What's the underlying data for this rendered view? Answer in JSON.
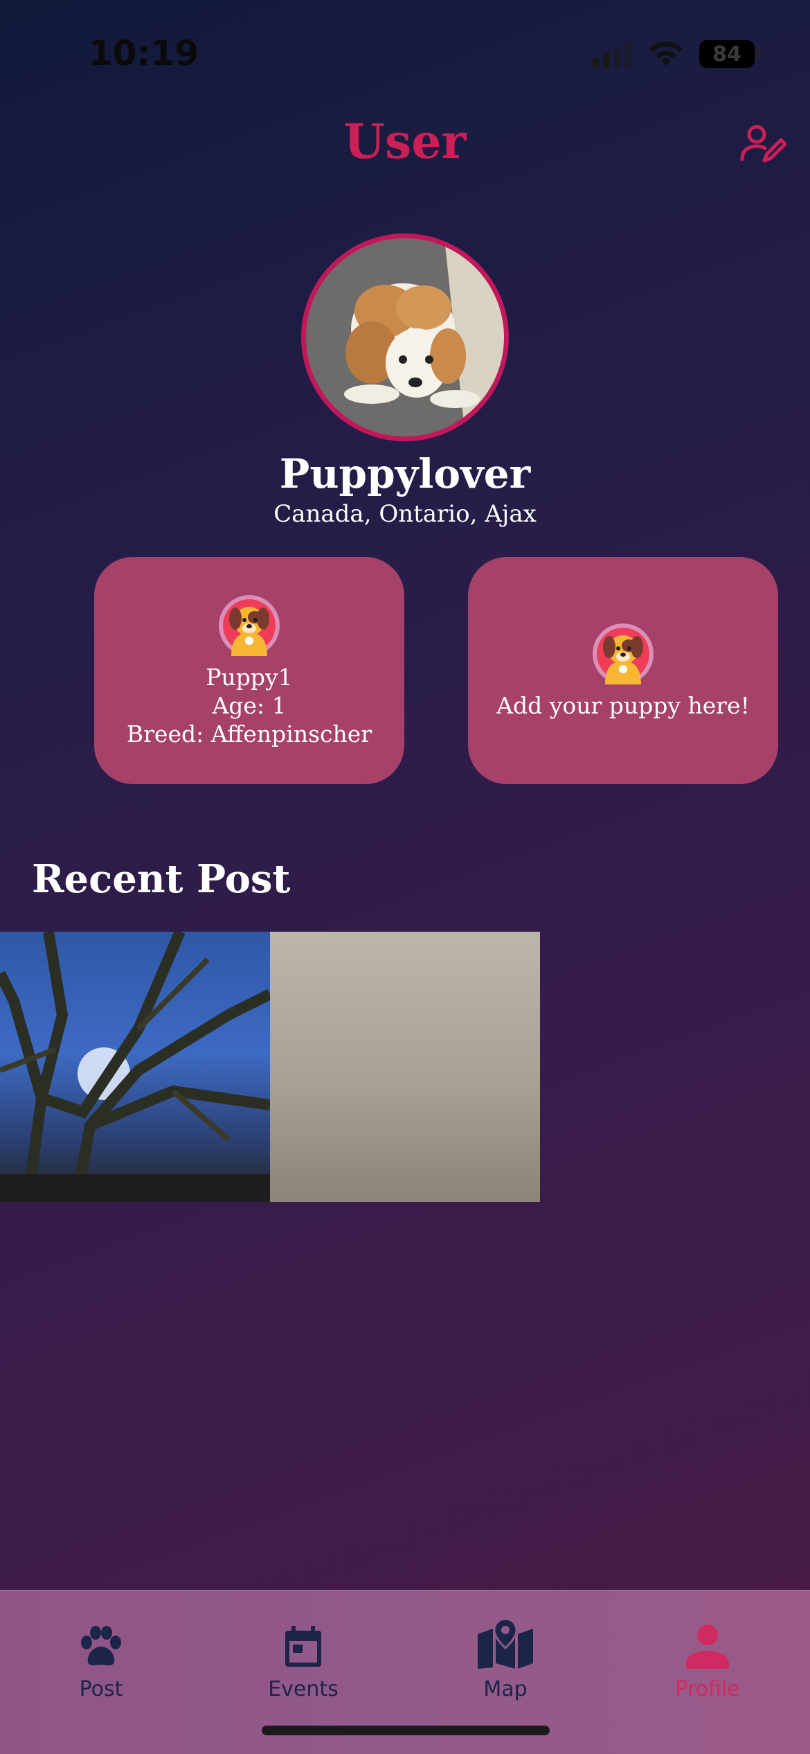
{
  "status_bar": {
    "time": "10:19",
    "battery": "84"
  },
  "header": {
    "title": "User",
    "edit_icon": "edit-user-icon"
  },
  "profile": {
    "username": "Puppylover",
    "location": "Canada, Ontario, Ajax"
  },
  "puppy_cards": [
    {
      "name": "Puppy1",
      "age": "Age: 1",
      "breed": "Breed: Affenpinscher"
    },
    {
      "label": "Add your puppy here!"
    }
  ],
  "recent_posts": {
    "title": "Recent Post"
  },
  "tab_bar": {
    "items": [
      {
        "label": "Post",
        "icon": "paw-icon"
      },
      {
        "label": "Events",
        "icon": "calendar-icon"
      },
      {
        "label": "Map",
        "icon": "map-icon"
      },
      {
        "label": "Profile",
        "icon": "person-icon"
      }
    ],
    "active": "Profile"
  },
  "colors": {
    "accent": "#cc1f55",
    "card": "#a64169",
    "tab_bar": "#925a8a",
    "tab_inactive": "#1a2547",
    "tab_active": "#d02a61"
  }
}
